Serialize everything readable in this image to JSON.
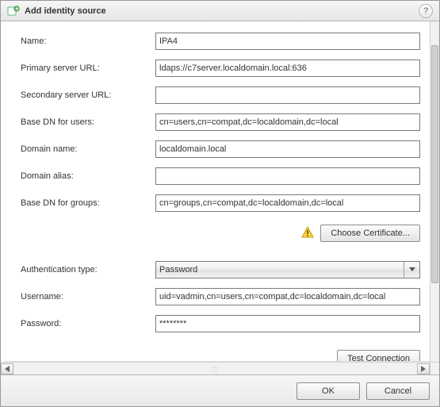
{
  "window": {
    "title": "Add identity source",
    "help_tooltip": "Help"
  },
  "fields": {
    "name": {
      "label": "Name:",
      "value": "IPA4"
    },
    "primary_url": {
      "label": "Primary server URL:",
      "value": "ldaps://c7server.localdomain.local:636"
    },
    "secondary_url": {
      "label": "Secondary server URL:",
      "value": ""
    },
    "base_dn_users": {
      "label": "Base DN for users:",
      "value": "cn=users,cn=compat,dc=localdomain,dc=local"
    },
    "domain_name": {
      "label": "Domain name:",
      "value": "localdomain.local"
    },
    "domain_alias": {
      "label": "Domain alias:",
      "value": ""
    },
    "base_dn_groups": {
      "label": "Base DN for groups:",
      "value": "cn=groups,cn=compat,dc=localdomain,dc=local"
    },
    "auth_type": {
      "label": "Authentication type:",
      "value": "Password"
    },
    "username": {
      "label": "Username:",
      "value": "uid=vadmin,cn=users,cn=compat,dc=localdomain,dc=local"
    },
    "password": {
      "label": "Password:",
      "value": "********"
    }
  },
  "buttons": {
    "choose_cert": "Choose Certificate...",
    "test_connection": "Test Connection",
    "ok": "OK",
    "cancel": "Cancel"
  }
}
